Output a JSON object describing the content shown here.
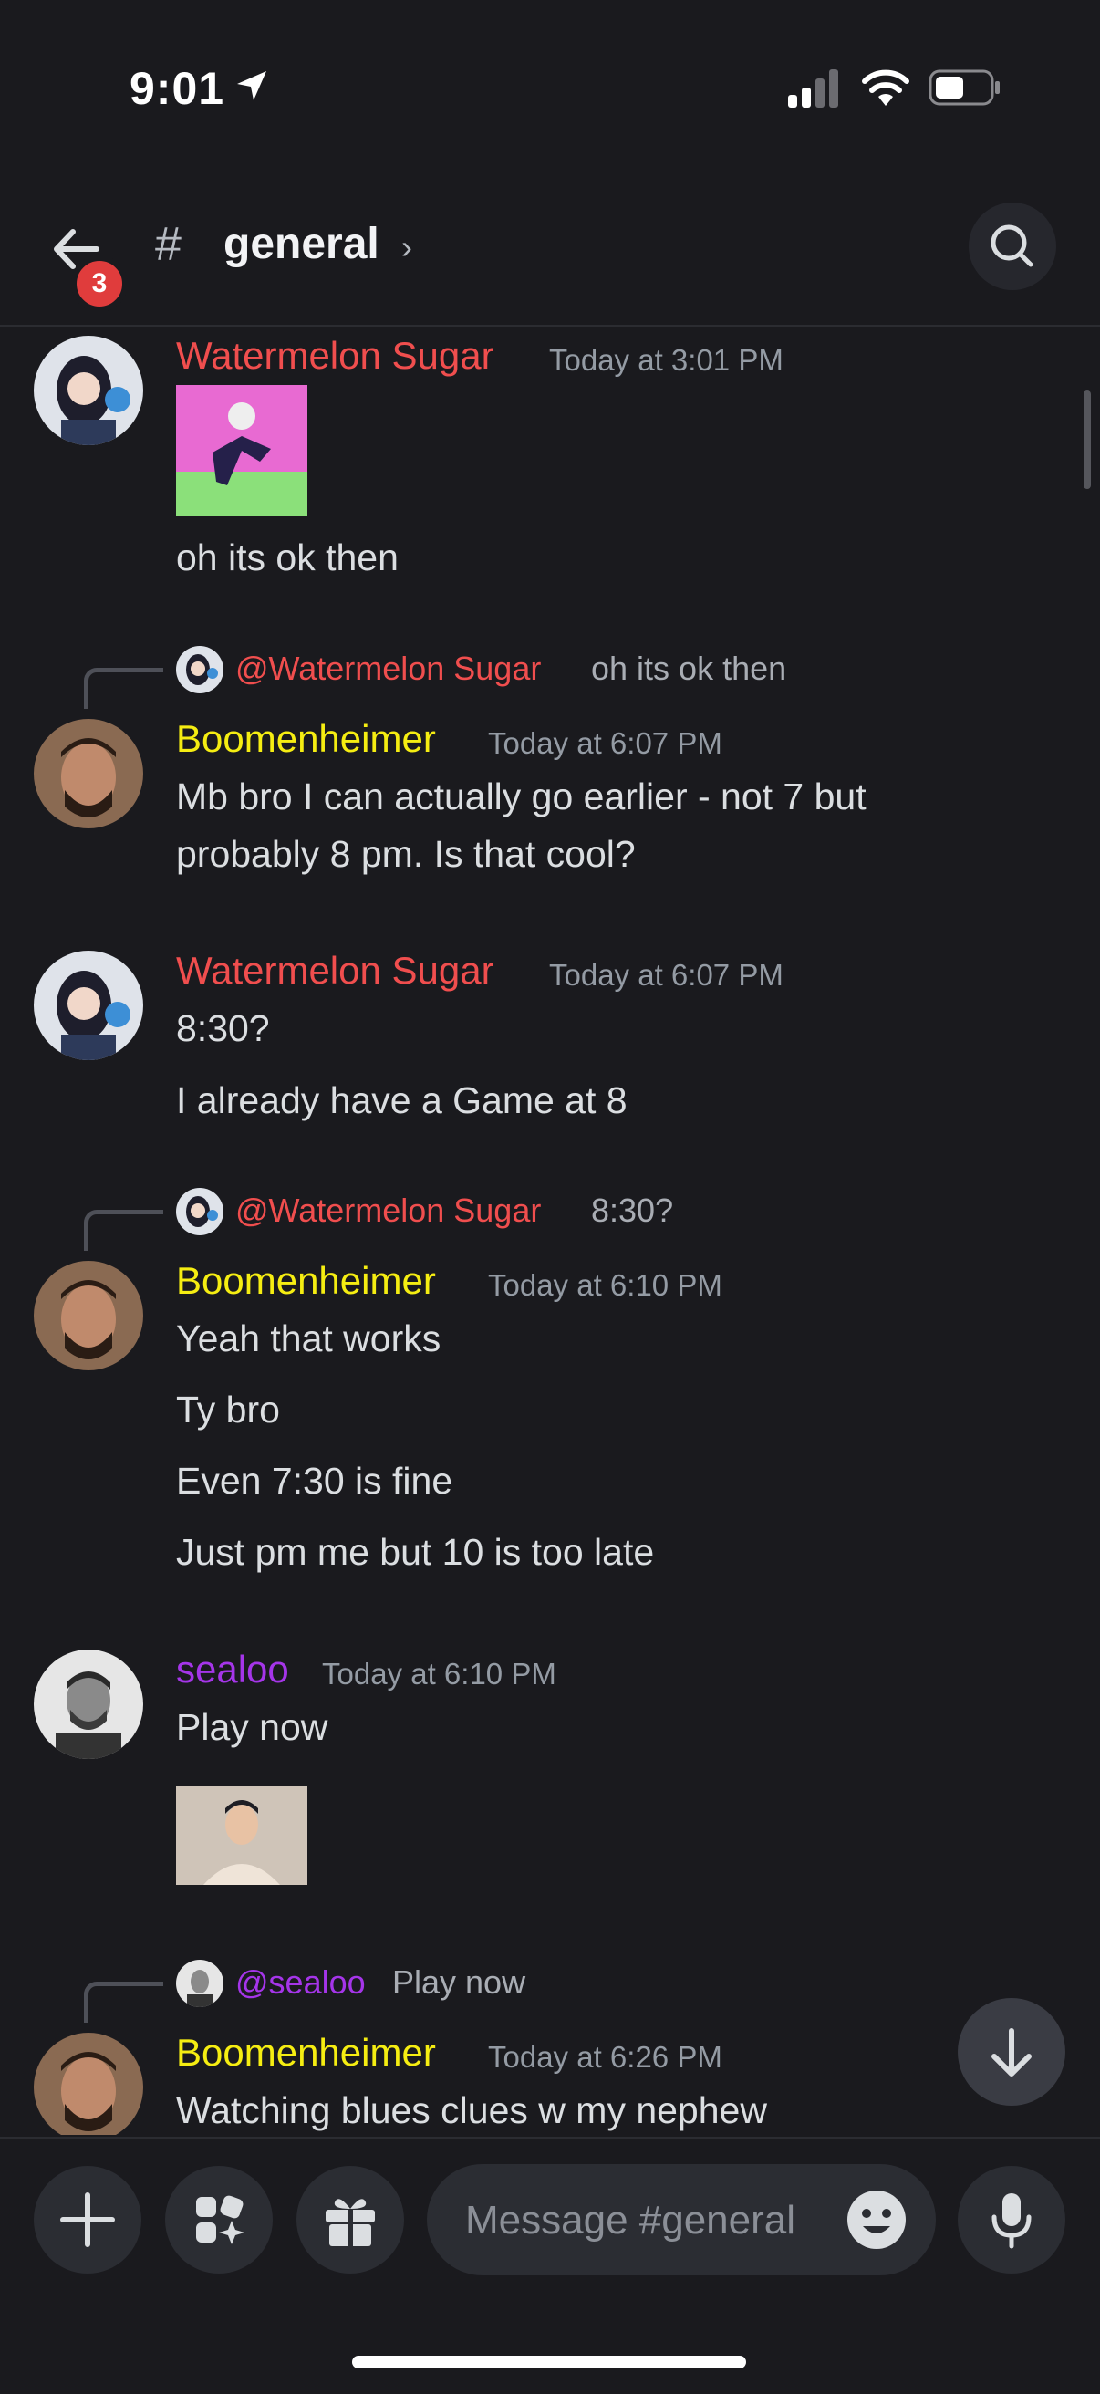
{
  "status": {
    "time": "9:01"
  },
  "header": {
    "channel": "general",
    "back_badge": "3"
  },
  "messages": {
    "m1": {
      "author": "Watermelon Sugar",
      "time": "Today at 3:01 PM",
      "text": "oh its ok then"
    },
    "m2": {
      "reply_to": "@Watermelon Sugar",
      "reply_text": "oh its ok then",
      "author": "Boomenheimer",
      "time": "Today at 6:07 PM",
      "line1": "Mb bro I can actually go earlier - not 7 but",
      "line2": "probably 8 pm. Is that cool?"
    },
    "m3": {
      "author": "Watermelon Sugar",
      "time": "Today at 6:07 PM",
      "lines": [
        "8:30?",
        "I already have a Game at 8"
      ]
    },
    "m4": {
      "reply_to": "@Watermelon Sugar",
      "reply_text": "8:30?",
      "author": "Boomenheimer",
      "time": "Today at 6:10 PM",
      "lines": [
        "Yeah that works",
        "Ty bro",
        "Even 7:30 is fine",
        "Just pm me but 10 is too late"
      ]
    },
    "m5": {
      "author": "sealoo",
      "time": "Today at 6:10 PM",
      "text": "Play now"
    },
    "m6": {
      "reply_to": "@sealoo",
      "reply_text": "Play now",
      "author": "Boomenheimer",
      "time": "Today at 6:26 PM",
      "text": "Watching blues clues w my nephew"
    }
  },
  "composer": {
    "placeholder": "Message #general"
  },
  "colors": {
    "watermelon": "#f04e4e",
    "boomenheimer": "#f5ed12",
    "sealoo": "#a535e9",
    "background": "#1a1a1e"
  },
  "icons": {
    "back": "arrow-left-icon",
    "search": "search-icon",
    "jump": "arrow-down-icon",
    "add": "plus-icon",
    "apps": "apps-icon",
    "gift": "gift-icon",
    "emoji": "emoji-icon",
    "mic": "microphone-icon"
  }
}
